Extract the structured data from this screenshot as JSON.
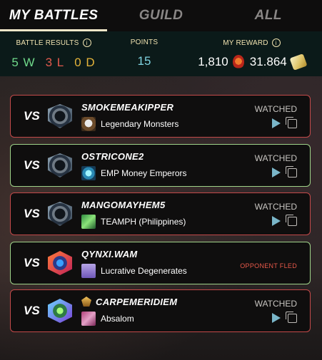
{
  "tabs": [
    {
      "label": "MY BATTLES",
      "active": true
    },
    {
      "label": "GUILD",
      "active": false
    },
    {
      "label": "ALL",
      "active": false
    }
  ],
  "summary": {
    "battle_results_label": "BATTLE RESULTS",
    "wins": "5 W",
    "losses": "3 L",
    "draws": "0 D",
    "points_label": "POINTS",
    "points": "15",
    "reward_label": "MY REWARD",
    "reward_1": "1,810",
    "reward_2": "31.864"
  },
  "info_glyph": "i",
  "vs_label": "VS",
  "battles": [
    {
      "result": "loss",
      "player": "SMOKEMEAKIPPER",
      "guild": "Legendary Monsters",
      "status": "WATCHED"
    },
    {
      "result": "win",
      "player": "OSTRICONE2",
      "guild": "EMP Money Emperors",
      "status": "WATCHED"
    },
    {
      "result": "loss",
      "player": "MANGOMAYHEM5",
      "guild": "TEAMPH (Philippines)",
      "status": "WATCHED"
    },
    {
      "result": "win",
      "player": "QYNXI.WAM",
      "guild": "Lucrative Degenerates",
      "status": "OPPONENT FLED"
    },
    {
      "result": "loss",
      "player": "CARPEMERIDIEM",
      "guild": "Absalom",
      "status": "WATCHED"
    }
  ],
  "colors": {
    "win_border": "#9fd389",
    "loss_border": "#c44a4a",
    "wins": "#6fd98a",
    "losses": "#e35a4d",
    "draws": "#e4b33a",
    "points": "#7fd3e0",
    "fled": "#e8594a",
    "play": "#7ab6c9"
  },
  "icons": {
    "reward_1": "red-gem-icon",
    "reward_2": "voucher-icon",
    "play": "play-icon",
    "copy": "copy-icon",
    "info": "info-icon"
  }
}
